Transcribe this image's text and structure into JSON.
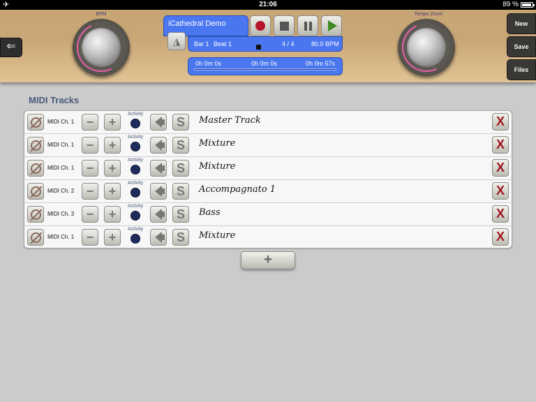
{
  "status_bar": {
    "time": "21:06",
    "battery": "89 %"
  },
  "header": {
    "bpm_label": "BPM",
    "tempo_zoom_label": "Tempo Zoom",
    "song_title": "iCathedral Demo",
    "position": {
      "bar": "Bar 1",
      "beat": "Beat 1",
      "time_signature": "4 / 4",
      "tempo": "80.0 BPM"
    },
    "timeline": {
      "start": "0h 0m 0s",
      "current": "0h 0m 0s",
      "end": "0h 0m 57s"
    },
    "buttons": {
      "new": "New",
      "save": "Save",
      "files": "Files"
    }
  },
  "tracks_title": "MIDI Tracks",
  "activity_label": "Activity",
  "tracks": [
    {
      "channel": "MIDI Ch. 1",
      "name": "Master Track"
    },
    {
      "channel": "MIDI Ch. 1",
      "name": "Mixture"
    },
    {
      "channel": "MIDI Ch. 1",
      "name": "Mixture"
    },
    {
      "channel": "MIDI Ch. 2",
      "name": "Accompagnato 1"
    },
    {
      "channel": "MIDI Ch. 3",
      "name": "Bass"
    },
    {
      "channel": "MIDI Ch. 1",
      "name": "Mixture"
    }
  ],
  "solo_label": "S",
  "delete_label": "X",
  "add_track_label": "+",
  "colors": {
    "accent_blue": "#4a76f0",
    "record_red": "#b5142a",
    "play_green": "#3e8a22",
    "delete_red": "#a0151f"
  }
}
